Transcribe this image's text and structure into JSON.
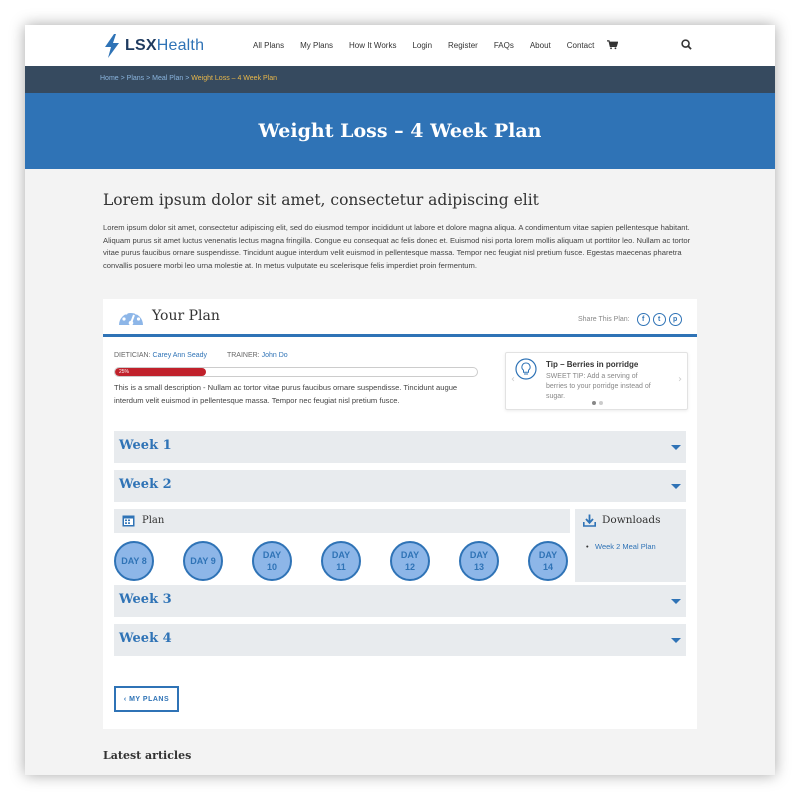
{
  "header": {
    "logo": {
      "part1": "LSX",
      "part2": "Health"
    },
    "nav": [
      "All Plans",
      "My Plans",
      "How It Works",
      "Login",
      "Register",
      "FAQs",
      "About",
      "Contact"
    ]
  },
  "breadcrumb": {
    "items": [
      "Home",
      "Plans",
      "Meal Plan"
    ],
    "separator": " > ",
    "current": "Weight Loss – 4 Week Plan"
  },
  "hero": {
    "title": "Weight Loss – 4 Week Plan"
  },
  "intro": {
    "title": "Lorem ipsum dolor sit amet, consectetur adipiscing elit",
    "text": "Lorem ipsum dolor sit amet, consectetur adipiscing elit, sed do eiusmod tempor incididunt ut labore et dolore magna aliqua. A condimentum vitae sapien pellentesque habitant. Aliquam purus sit amet luctus venenatis lectus magna fringilla. Congue eu consequat ac felis donec et. Euismod nisi porta lorem mollis aliquam ut porttitor leo. Nullam ac tortor vitae purus faucibus ornare suspendisse. Tincidunt augue interdum velit euismod in pellentesque massa. Tempor nec feugiat nisl pretium fusce. Egestas maecenas pharetra convallis posuere morbi leo urna molestie at. In metus vulputate eu scelerisque felis imperdiet proin fermentum."
  },
  "plan": {
    "title": "Your Plan",
    "share_label": "Share This Plan:",
    "share_icons": [
      "f",
      "t",
      "p"
    ],
    "dietician_label": "DIETICIAN:",
    "dietician": "Carey Ann Seady",
    "trainer_label": "TRAINER:",
    "trainer": "John Do",
    "progress_label": "25%",
    "progress_value": 25,
    "description": "This is a small description - Nullam ac tortor vitae purus faucibus ornare suspendisse. Tincidunt augue interdum velit euismod in pellentesque massa. Tempor nec feugiat nisl pretium fusce.",
    "tip": {
      "title": "Tip – Berries in porridge",
      "text": "SWEET TIP: Add a serving of berries to your porridge instead of sugar."
    },
    "weeks": [
      "Week 1",
      "Week 2",
      "Week 3",
      "Week 4"
    ],
    "plan_label": "Plan",
    "days": [
      {
        "a": "DAY 8",
        "b": ""
      },
      {
        "a": "DAY 9",
        "b": ""
      },
      {
        "a": "DAY",
        "b": "10"
      },
      {
        "a": "DAY",
        "b": "11"
      },
      {
        "a": "DAY",
        "b": "12"
      },
      {
        "a": "DAY",
        "b": "13"
      },
      {
        "a": "DAY",
        "b": "14"
      }
    ],
    "downloads_title": "Downloads",
    "downloads": [
      "Week 2 Meal Plan"
    ],
    "back_button": "‹  MY PLANS"
  },
  "latest": {
    "title": "Latest articles"
  },
  "colors": {
    "accent": "#2f73b6",
    "progress": "#c0212b",
    "crumb_bar": "#364a5f",
    "current_crumb": "#e9b84a"
  }
}
